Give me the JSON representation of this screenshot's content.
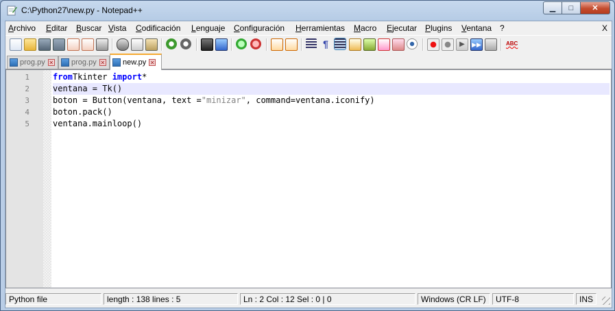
{
  "window": {
    "title": "C:\\Python27\\new.py - Notepad++"
  },
  "caption_buttons": {
    "minimize": "▁",
    "maximize": "□",
    "close": "✕"
  },
  "menu": {
    "items": [
      "Archivo",
      "Editar",
      "Buscar",
      "Vista",
      "Codificación",
      "Lenguaje",
      "Configuración",
      "Herramientas",
      "Macro",
      "Ejecutar",
      "Plugins",
      "Ventana",
      "?"
    ],
    "close_doc": "X"
  },
  "toolbar": {
    "icons": [
      "new-file-icon",
      "open-file-icon",
      "save-icon",
      "save-all-icon",
      "close-icon",
      "close-all-icon",
      "print-icon",
      "cut-icon",
      "copy-icon",
      "paste-icon",
      "undo-icon",
      "redo-icon",
      "find-icon",
      "replace-icon",
      "zoom-in-icon",
      "zoom-out-icon",
      "sync-vertical-icon",
      "sync-horizontal-icon",
      "word-wrap-icon",
      "show-all-chars-icon",
      "indent-guide-icon",
      "user-language-icon",
      "doc-map-icon",
      "function-list-icon",
      "folder-workspace-icon",
      "monitoring-icon",
      "record-macro-icon",
      "stop-macro-icon",
      "play-macro-icon",
      "run-macro-multiple-icon",
      "save-macro-icon",
      "spell-check-icon"
    ]
  },
  "tabs": [
    {
      "label": "prog.py",
      "active": false
    },
    {
      "label": "prog.py",
      "active": false
    },
    {
      "label": "new.py",
      "active": true
    }
  ],
  "editor": {
    "current_line": 2,
    "lines": [
      {
        "n": "1",
        "tokens": [
          [
            "kw",
            "from"
          ],
          [
            "",
            "Tkinter "
          ],
          [
            "kw",
            "import"
          ],
          [
            "",
            "*"
          ]
        ]
      },
      {
        "n": "2",
        "tokens": [
          [
            "",
            "ventana = Tk()"
          ]
        ]
      },
      {
        "n": "3",
        "tokens": [
          [
            "",
            "boton = Button(ventana, text ="
          ],
          [
            "str",
            "\"minizar\""
          ],
          [
            "",
            ", command=ventana.iconify)"
          ]
        ]
      },
      {
        "n": "4",
        "tokens": [
          [
            "",
            "boton.pack()"
          ]
        ]
      },
      {
        "n": "5",
        "tokens": [
          [
            "",
            "ventana.mainloop()"
          ]
        ]
      }
    ]
  },
  "status": {
    "file_type": "Python file",
    "length": "length : 138    lines : 5",
    "position": "Ln : 2    Col : 12    Sel : 0 | 0",
    "eol": "Windows (CR LF)",
    "encoding": "UTF-8",
    "mode": "INS"
  },
  "colors": {
    "keyword": "#0000ff",
    "string": "#808080",
    "current_line": "#e8e8ff",
    "active_tab_accent": "#f6a930"
  }
}
